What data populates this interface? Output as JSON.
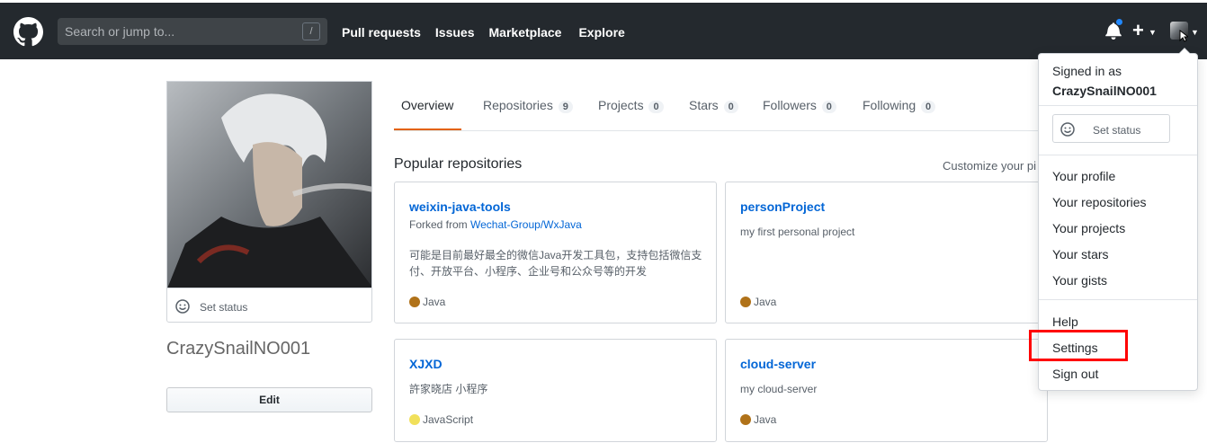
{
  "header": {
    "search_placeholder": "Search or jump to...",
    "search_key": "/",
    "nav": [
      "Pull requests",
      "Issues",
      "Marketplace",
      "Explore"
    ],
    "plus_label": "+"
  },
  "profile": {
    "set_status": "Set status",
    "username": "CrazySnailNO001",
    "edit_label": "Edit"
  },
  "tabs": [
    {
      "label": "Overview"
    },
    {
      "label": "Repositories",
      "count": "9"
    },
    {
      "label": "Projects",
      "count": "0"
    },
    {
      "label": "Stars",
      "count": "0"
    },
    {
      "label": "Followers",
      "count": "0"
    },
    {
      "label": "Following",
      "count": "0"
    }
  ],
  "popular": {
    "title": "Popular repositories",
    "customize": "Customize your pi"
  },
  "repos": [
    {
      "name": "weixin-java-tools",
      "forked_prefix": "Forked from ",
      "forked_link": "Wechat-Group/WxJava",
      "desc": "可能是目前最好最全的微信Java开发工具包，支持包括微信支付、开放平台、小程序、企业号和公众号等的开发",
      "lang": "Java",
      "lang_color": "#b07219"
    },
    {
      "name": "personProject",
      "desc": "my first personal project",
      "lang": "Java",
      "lang_color": "#b07219"
    },
    {
      "name": "XJXD",
      "desc": "許家晓店 小程序",
      "lang": "JavaScript",
      "lang_color": "#f1e05a"
    },
    {
      "name": "cloud-server",
      "desc": "my cloud-server",
      "lang": "Java",
      "lang_color": "#b07219"
    }
  ],
  "dropdown": {
    "signed_in_as": "Signed in as",
    "user": "CrazySnailNO001",
    "set_status": "Set status",
    "items": [
      "Your profile",
      "Your repositories",
      "Your projects",
      "Your stars",
      "Your gists"
    ],
    "items2": [
      "Help",
      "Settings",
      "Sign out"
    ]
  },
  "colors": {
    "header_bg": "#24292e",
    "link": "#0366d6",
    "tab_active": "#e36209",
    "highlight": "#ff0000"
  }
}
